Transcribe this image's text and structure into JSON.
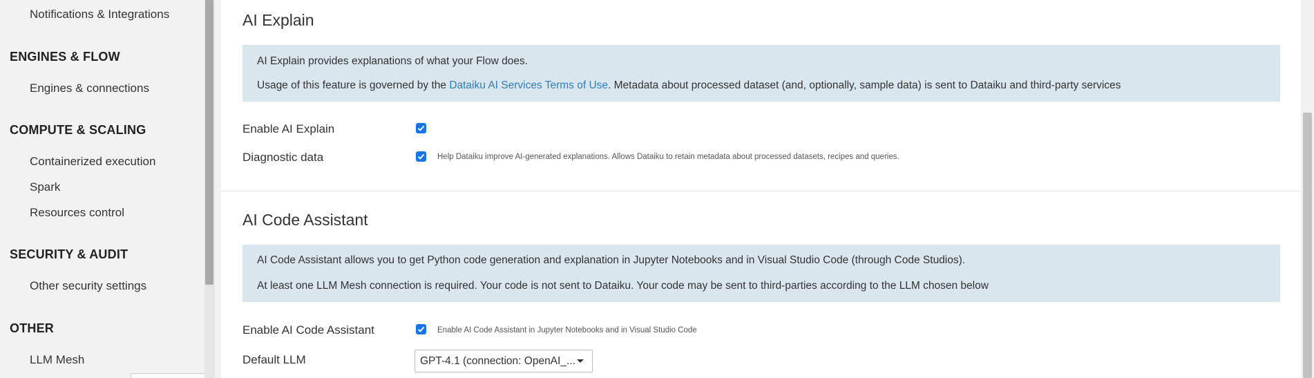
{
  "sidebar": {
    "items": [
      {
        "kind": "item",
        "label": "Notifications & Integrations"
      },
      {
        "kind": "header",
        "label": "ENGINES & FLOW"
      },
      {
        "kind": "item",
        "label": "Engines & connections"
      },
      {
        "kind": "header",
        "label": "COMPUTE & SCALING"
      },
      {
        "kind": "item",
        "label": "Containerized execution"
      },
      {
        "kind": "item",
        "label": "Spark"
      },
      {
        "kind": "item",
        "label": "Resources control"
      },
      {
        "kind": "header",
        "label": "SECURITY & AUDIT"
      },
      {
        "kind": "item",
        "label": "Other security settings"
      },
      {
        "kind": "header",
        "label": "OTHER"
      },
      {
        "kind": "item",
        "label": "LLM Mesh"
      }
    ]
  },
  "ai_explain": {
    "title": "AI Explain",
    "info_line1": "AI Explain provides explanations of what your Flow does.",
    "info_line2_prefix": "Usage of this feature is governed by the ",
    "info_line2_link": "Dataiku AI Services Terms of Use",
    "info_line2_suffix": ". Metadata about processed dataset (and, optionally, sample data) is sent to Dataiku and third-party services",
    "enable_label": "Enable AI Explain",
    "enable_checked": true,
    "diagnostic_label": "Diagnostic data",
    "diagnostic_checked": true,
    "diagnostic_help": "Help Dataiku improve AI-generated explanations. Allows Dataiku to retain metadata about processed datasets, recipes and queries."
  },
  "ai_code_assistant": {
    "title": "AI Code Assistant",
    "info_line1": "AI Code Assistant allows you to get Python code generation and explanation in Jupyter Notebooks and in Visual Studio Code (through Code Studios).",
    "info_line2": "At least one LLM Mesh connection is required. Your code is not sent to Dataiku. Your code may be sent to third-parties according to the LLM chosen below",
    "enable_label": "Enable AI Code Assistant",
    "enable_checked": true,
    "enable_help": "Enable AI Code Assistant in Jupyter Notebooks and in Visual Studio Code",
    "default_llm_label": "Default LLM",
    "default_llm_value": "GPT-4.1 (connection: OpenAI_..."
  },
  "colors": {
    "checkbox": "#1a73e8",
    "infobox_bg": "#dae6ee",
    "link": "#2f7fb6"
  }
}
